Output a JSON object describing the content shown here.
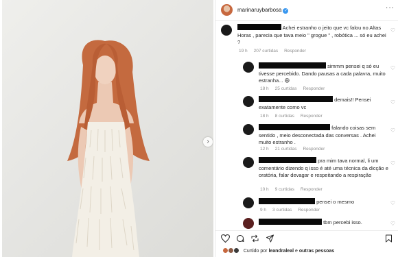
{
  "post": {
    "username": "marinaruybarbosa",
    "verified_mark": "✓",
    "more_label": "···"
  },
  "carousel": {
    "next_label": "›"
  },
  "comments": [
    {
      "text": "Achei estranho o jeito que vc falou no Altas Horas , parecia que tava meio \" grogue \" , robótica ... só eu achei ?",
      "time": "19 h",
      "likes": "207 curtidas",
      "reply": "Responder"
    },
    {
      "text1": "simmm pensei q só eu",
      "text2": "tivesse percebido. Dando pausas a cada palavra, muito estranha... 😄",
      "time": "18 h",
      "likes": "25 curtidas",
      "reply": "Responder"
    },
    {
      "text1": "demais!! Pensei",
      "text2": "exatamente como vc",
      "time": "18 h",
      "likes": "8 curtidas",
      "reply": "Responder"
    },
    {
      "text1": "falando coisas sem",
      "text2": "sentido , meio desconectada das conversas . Achei muito estranho .",
      "time": "12 h",
      "likes": "21 curtidas",
      "reply": "Responder"
    },
    {
      "text1": "pra mim tava normal, li um",
      "text2": "comentário dizendo q isso é até uma técnica da dicção e oratória, falar devagar e respeitando a respiração",
      "time": "10 h",
      "likes": "9 curtidas",
      "reply": "Responder"
    },
    {
      "text1": "pensei o mesmo",
      "time": "9 h",
      "likes": "3 curtidas",
      "reply": "Responder"
    },
    {
      "text1": "tbm percebi isso."
    }
  ],
  "actions": {
    "like_icon": "heart-icon",
    "comment_icon": "comment-icon",
    "share_icon": "share-icon",
    "save_icon": "bookmark-icon"
  },
  "liked_by": {
    "prefix": "Curtido por",
    "user": "leandraleal",
    "connector": "e",
    "others": "outras pessoas"
  },
  "colors": {
    "accent": "#3897f0",
    "hair": "#c7683f",
    "text": "#262626",
    "meta": "#8e8e8e"
  }
}
